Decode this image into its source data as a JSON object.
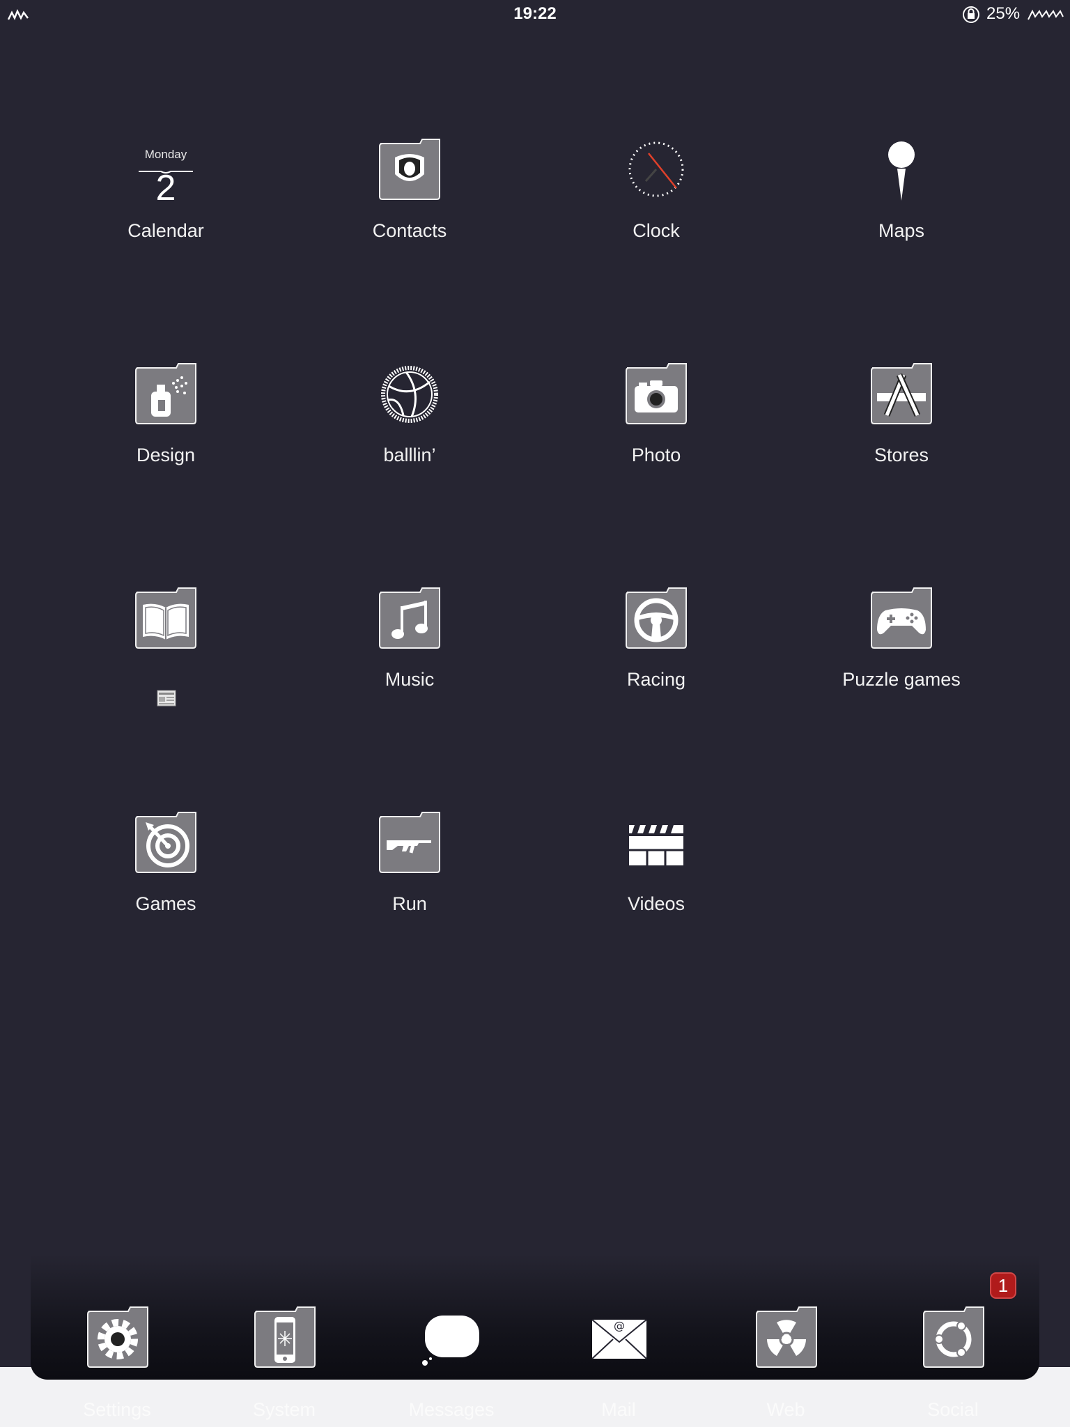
{
  "status_bar": {
    "time": "19:22",
    "battery_percent": "25%",
    "icons": [
      "signal-icon",
      "rotation-lock-icon",
      "battery-icon"
    ]
  },
  "calendar_widget": {
    "weekday": "Monday",
    "day": "2"
  },
  "apps": [
    {
      "label": "Calendar",
      "icon": "calendar-icon"
    },
    {
      "label": "Contacts",
      "icon": "contacts-folder-icon"
    },
    {
      "label": "Clock",
      "icon": "clock-icon"
    },
    {
      "label": "Maps",
      "icon": "map-pin-icon"
    },
    {
      "label": "Design",
      "icon": "spray-can-folder-icon"
    },
    {
      "label": "balllin’",
      "icon": "basketball-icon"
    },
    {
      "label": "Photo",
      "icon": "camera-folder-icon"
    },
    {
      "label": "Stores",
      "icon": "app-store-folder-icon"
    },
    {
      "label": "",
      "icon": "book-folder-icon",
      "label_icon": "newspaper-icon"
    },
    {
      "label": "Music",
      "icon": "music-note-folder-icon"
    },
    {
      "label": "Racing",
      "icon": "steering-wheel-folder-icon"
    },
    {
      "label": "Puzzle games",
      "icon": "gamepad-folder-icon"
    },
    {
      "label": "Games",
      "icon": "target-folder-icon"
    },
    {
      "label": "Run",
      "icon": "rifle-folder-icon"
    },
    {
      "label": "Videos",
      "icon": "clapperboard-icon"
    }
  ],
  "dock": [
    {
      "label": "Settings",
      "icon": "gear-folder-icon"
    },
    {
      "label": "System",
      "icon": "phone-folder-icon"
    },
    {
      "label": "Messages",
      "icon": "speech-bubble-icon"
    },
    {
      "label": "Mail",
      "icon": "envelope-icon"
    },
    {
      "label": "Web",
      "icon": "radiation-folder-icon"
    },
    {
      "label": "Social",
      "icon": "ubuntu-folder-icon",
      "badge": "1"
    }
  ],
  "colors": {
    "background": "#262532",
    "folder_fill": "#7c7b80",
    "badge": "#b01b1b",
    "clock_second_hand": "#e0402a"
  }
}
